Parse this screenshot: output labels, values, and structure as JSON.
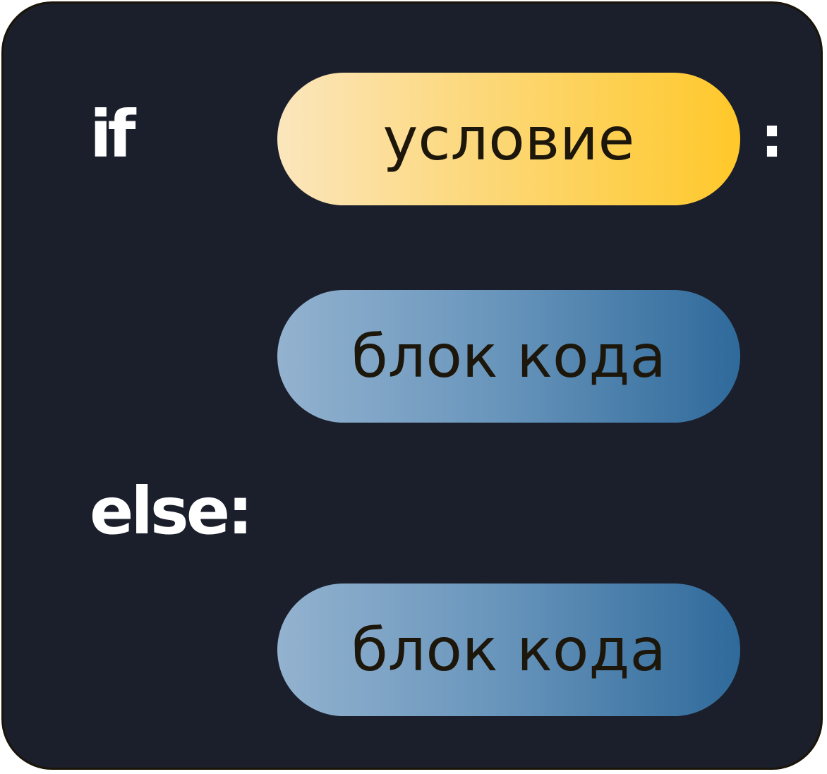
{
  "diagram": {
    "keyword_if": "if",
    "condition_label": "условие",
    "colon": ":",
    "block_1_label": "блок кода",
    "keyword_else": "else:",
    "block_2_label": "блок кода"
  },
  "colors": {
    "background": "#1b1f2b",
    "keyword_text": "#ffffff",
    "condition_gradient": [
      "#fbe6bd",
      "#ffc82a"
    ],
    "block_gradient": [
      "#93b2cf",
      "#2f6a9b"
    ],
    "pill_text": "#1c160b"
  }
}
